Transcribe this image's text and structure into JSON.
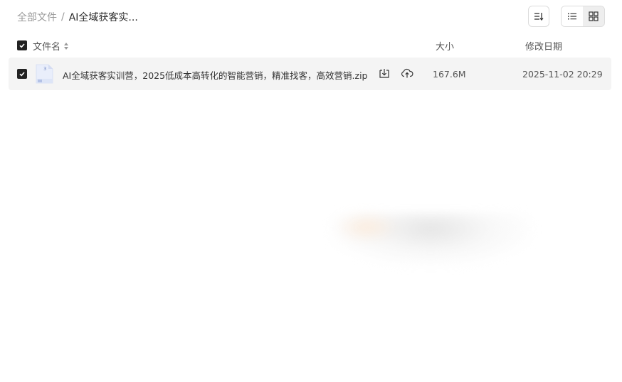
{
  "breadcrumb": {
    "root": "全部文件",
    "separator": "/",
    "current": "AI全域获客实..."
  },
  "toolbar": {
    "sort_icon": "sort-icon",
    "list_view_icon": "list-view-icon",
    "grid_view_icon": "grid-view-icon"
  },
  "table": {
    "columns": {
      "name": "文件名",
      "size": "大小",
      "date": "修改日期"
    },
    "rows": [
      {
        "name": "AI全域获客实训营，2025低成本高转化的智能营销，精准找客，高效营销.zip",
        "size": "167.6M",
        "date": "2025-11-02 20:29",
        "selected": true,
        "icon": "zip-file-icon"
      }
    ]
  },
  "colors": {
    "checkbox": "#222222",
    "row_bg": "#f4f4f4",
    "muted_text": "#9a9a9a"
  }
}
